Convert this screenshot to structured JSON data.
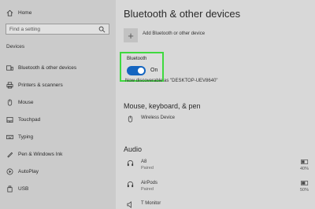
{
  "sidebar": {
    "home_label": "Home",
    "search_placeholder": "Find a setting",
    "section_label": "Devices",
    "items": [
      {
        "label": "Bluetooth & other devices"
      },
      {
        "label": "Printers & scanners"
      },
      {
        "label": "Mouse"
      },
      {
        "label": "Touchpad"
      },
      {
        "label": "Typing"
      },
      {
        "label": "Pen & Windows Ink"
      },
      {
        "label": "AutoPlay"
      },
      {
        "label": "USB"
      }
    ]
  },
  "main": {
    "title": "Bluetooth & other devices",
    "add_label": "Add Bluetooth or other device",
    "bluetooth": {
      "label": "Bluetooth",
      "state": "On"
    },
    "discoverable": "Now discoverable as \"DESKTOP-UEV8640\"",
    "mkp_heading": "Mouse, keyboard, & pen",
    "mkp_devices": [
      {
        "name": "Wireless Device"
      }
    ],
    "audio_heading": "Audio",
    "audio_devices": [
      {
        "name": "A8",
        "status": "Paired",
        "battery": "40%"
      },
      {
        "name": "AirPods",
        "status": "Paired",
        "battery": "50%"
      },
      {
        "name": "T Monitor",
        "status": "",
        "battery": ""
      }
    ]
  },
  "colors": {
    "accent": "#1565c0",
    "highlight": "#3fd93f"
  }
}
